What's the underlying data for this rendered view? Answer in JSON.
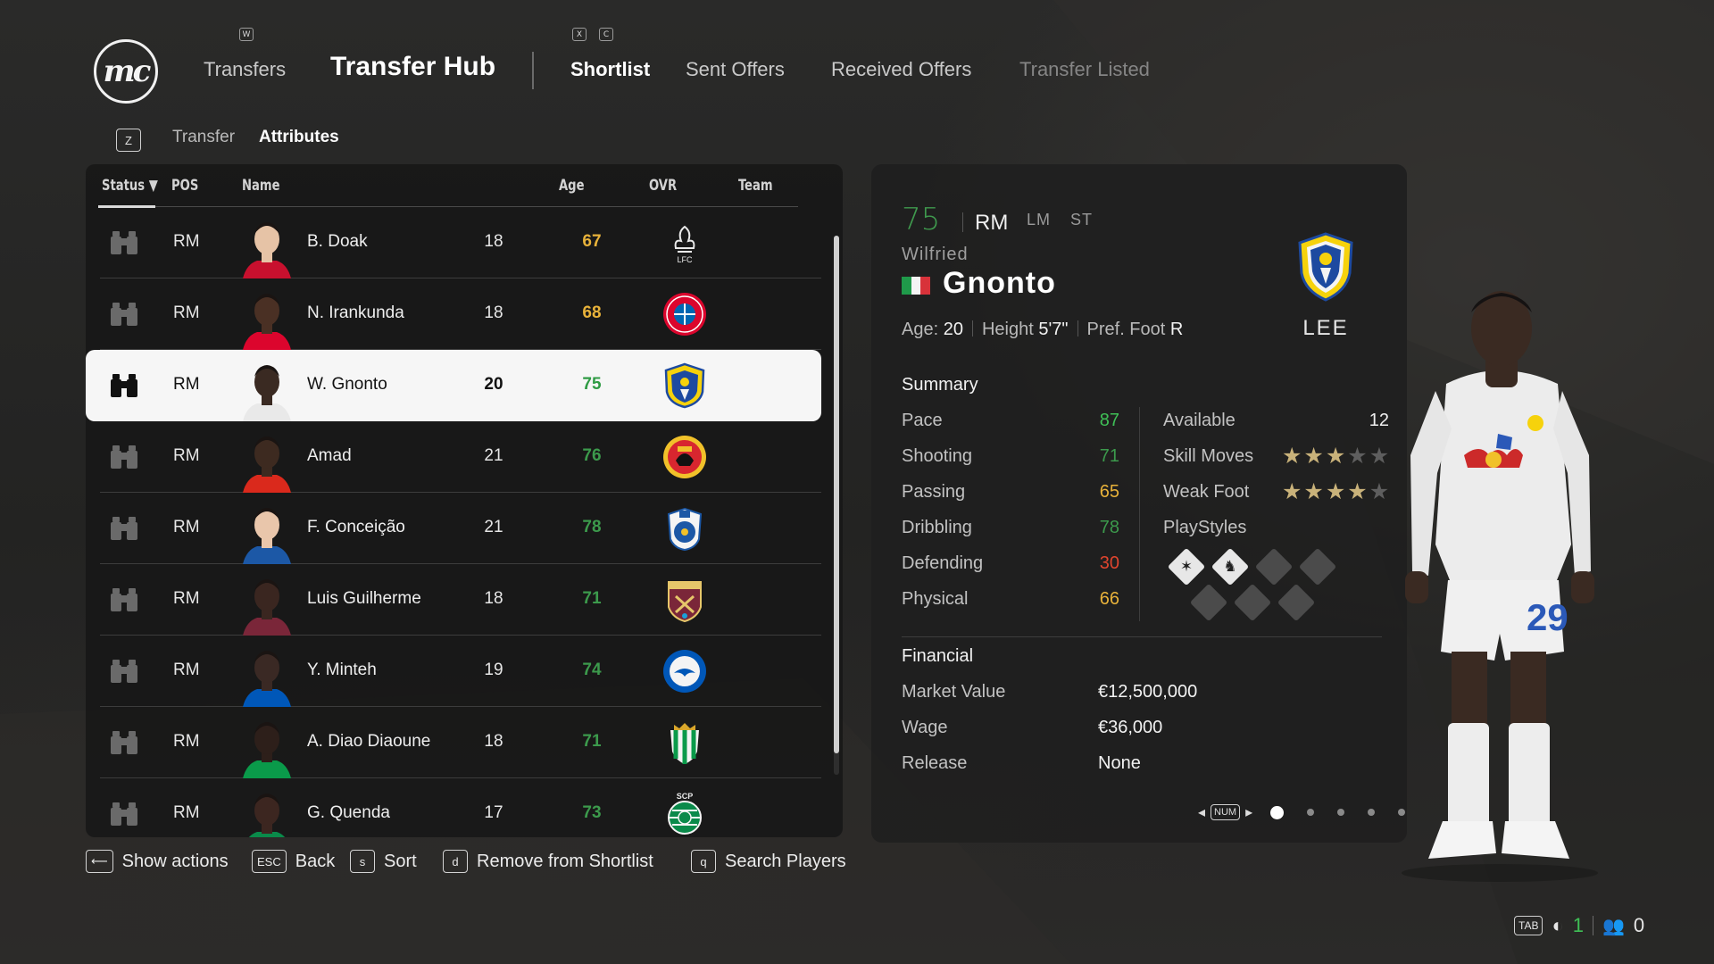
{
  "header": {
    "logo_text": "mc",
    "nav_transfers": "Transfers",
    "nav_title": "Transfer Hub",
    "key_w": "W",
    "key_x": "X",
    "key_c": "C",
    "tabs": [
      "Shortlist",
      "Sent Offers",
      "Received Offers",
      "Transfer Listed"
    ],
    "active_tab": "Shortlist"
  },
  "subnav": {
    "key": "Z",
    "tabs": [
      "Transfer",
      "Attributes"
    ],
    "active": "Attributes"
  },
  "table": {
    "columns": {
      "status": "Status",
      "sort_icon": "▼",
      "pos": "POS",
      "name": "Name",
      "age": "Age",
      "ovr": "OVR",
      "team": "Team"
    },
    "rows": [
      {
        "pos": "RM",
        "name": "B. Doak",
        "age": "18",
        "ovr": "67",
        "ovr_color": "#e8b23a",
        "team_icon": "liverpool-crest",
        "selected": false
      },
      {
        "pos": "RM",
        "name": "N. Irankunda",
        "age": "18",
        "ovr": "68",
        "ovr_color": "#e8b23a",
        "team_icon": "bayern-crest",
        "selected": false
      },
      {
        "pos": "RM",
        "name": "W. Gnonto",
        "age": "20",
        "ovr": "75",
        "ovr_color": "#2f9b44",
        "team_icon": "leeds-crest",
        "selected": true
      },
      {
        "pos": "RM",
        "name": "Amad",
        "age": "21",
        "ovr": "76",
        "ovr_color": "#3c9a4c",
        "team_icon": "man-utd-crest",
        "selected": false
      },
      {
        "pos": "RM",
        "name": "F. Conceição",
        "age": "21",
        "ovr": "78",
        "ovr_color": "#3c9a4c",
        "team_icon": "porto-crest",
        "selected": false
      },
      {
        "pos": "RM",
        "name": "Luis Guilherme",
        "age": "18",
        "ovr": "71",
        "ovr_color": "#3c9a4c",
        "team_icon": "west-ham-crest",
        "selected": false
      },
      {
        "pos": "RM",
        "name": "Y. Minteh",
        "age": "19",
        "ovr": "74",
        "ovr_color": "#3c9a4c",
        "team_icon": "brighton-crest",
        "selected": false
      },
      {
        "pos": "RM",
        "name": "A. Diao Diaoune",
        "age": "18",
        "ovr": "71",
        "ovr_color": "#3c9a4c",
        "team_icon": "betis-crest",
        "selected": false
      },
      {
        "pos": "RM",
        "name": "G. Quenda",
        "age": "17",
        "ovr": "73",
        "ovr_color": "#3c9a4c",
        "team_icon": "sporting-crest",
        "selected": false
      }
    ]
  },
  "actions": [
    {
      "key": "⟵",
      "label": "Show actions"
    },
    {
      "key": "ESC",
      "label": "Back"
    },
    {
      "key": "s",
      "label": "Sort"
    },
    {
      "key": "d",
      "label": "Remove from Shortlist"
    },
    {
      "key": "q",
      "label": "Search Players"
    }
  ],
  "player": {
    "ovr": "75",
    "position": "RM",
    "alt_positions": [
      "LM",
      "ST"
    ],
    "first_name": "Wilfried",
    "last_name": "Gnonto",
    "nation_flag": "italy-flag",
    "age_label": "Age:",
    "age": "20",
    "height_label": "Height",
    "height": "5'7\"",
    "foot_label": "Pref. Foot",
    "foot": "R",
    "club": "LEE",
    "club_icon": "leeds-crest"
  },
  "summary": {
    "title": "Summary",
    "stats": [
      {
        "label": "Pace",
        "value": "87",
        "color": "#3fbf56"
      },
      {
        "label": "Shooting",
        "value": "71",
        "color": "#3c9a4c"
      },
      {
        "label": "Passing",
        "value": "65",
        "color": "#e8b23a"
      },
      {
        "label": "Dribbling",
        "value": "78",
        "color": "#3c9a4c"
      },
      {
        "label": "Defending",
        "value": "30",
        "color": "#e0452e"
      },
      {
        "label": "Physical",
        "value": "66",
        "color": "#e8b23a"
      }
    ],
    "available_label": "Available",
    "available": "12",
    "skill_moves_label": "Skill Moves",
    "skill_moves": 3,
    "weak_foot_label": "Weak Foot",
    "weak_foot": 4,
    "stars_max": 5,
    "playstyles_label": "PlayStyles",
    "playstyles_filled": 2,
    "playstyles_total": 7
  },
  "financial": {
    "title": "Financial",
    "market_value_label": "Market Value",
    "market_value": "€12,500,000",
    "wage_label": "Wage",
    "wage": "€36,000",
    "release_label": "Release",
    "release": "None"
  },
  "pager": {
    "key": "NUM",
    "pages": 5,
    "current": 1
  },
  "status_bar": {
    "key": "TAB",
    "online_count": "1",
    "friends_count": "0"
  }
}
